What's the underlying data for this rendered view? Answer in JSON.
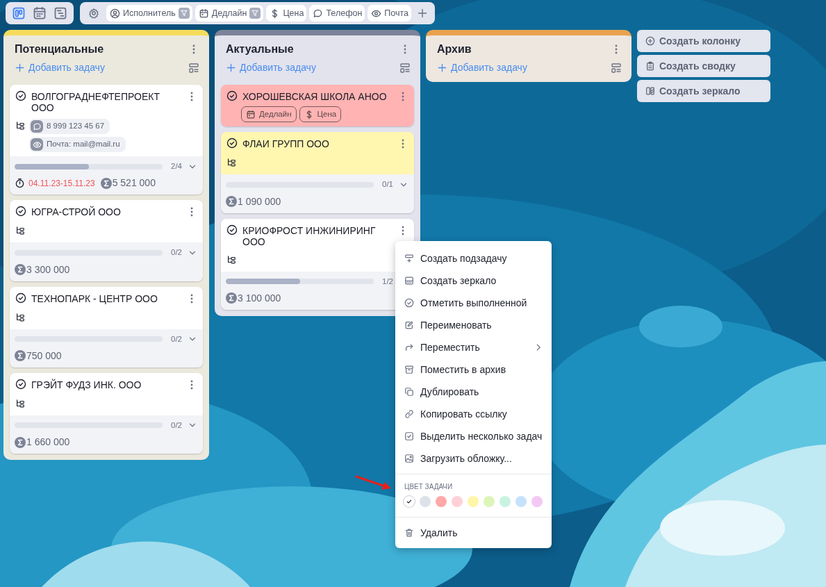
{
  "toolbar": {
    "views": [
      {
        "kind": "board",
        "selected": true
      },
      {
        "kind": "calendar",
        "selected": false
      },
      {
        "kind": "gantt",
        "selected": false
      }
    ],
    "fields": [
      {
        "kind": "user",
        "label": "Исполнитель",
        "filtered": true
      },
      {
        "kind": "calendar",
        "label": "Дедлайн",
        "filtered": true
      },
      {
        "kind": "dollar",
        "label": "Цена",
        "filtered": false
      },
      {
        "kind": "chat",
        "label": "Телефон",
        "filtered": false
      },
      {
        "kind": "eye",
        "label": "Почта",
        "filtered": false
      }
    ]
  },
  "columns": [
    {
      "title": "Потенциальные",
      "color": "#f5dc5c",
      "add_label": "Добавить задачу",
      "cards": [
        {
          "title": "ВОЛГОГРАДНЕФТЕПРОЕКТ ООО",
          "color": "#ffffff",
          "has_subtasks": true,
          "fields": [
            {
              "kind": "chat",
              "text": "8 999 123 45 67"
            },
            {
              "kind": "eye",
              "text": "Почта: mail@mail.ru"
            }
          ],
          "progress": {
            "level": 0.5,
            "text": "2/4"
          },
          "deadline": {
            "text": "04.11.23-15.11.23",
            "overdue": true
          },
          "sum": "5 521 000"
        },
        {
          "title": "ЮГРА-СТРОЙ ООО",
          "color": "#ffffff",
          "has_subtasks": true,
          "progress": {
            "level": 0,
            "text": "0/2"
          },
          "sum": "3 300 000"
        },
        {
          "title": "ТЕХНОПАРК - ЦЕНТР ООО",
          "color": "#ffffff",
          "has_subtasks": true,
          "progress": {
            "level": 0,
            "text": "0/2"
          },
          "sum": "750 000"
        },
        {
          "title": "ГРЭЙТ ФУДЗ ИНК. ООО",
          "color": "#ffffff",
          "has_subtasks": true,
          "progress": {
            "level": 0,
            "text": "0/2"
          },
          "sum": "1 660 000"
        }
      ]
    },
    {
      "title": "Актуальные",
      "color": "#7d8398",
      "add_label": "Добавить задачу",
      "cards": [
        {
          "title": "ХОРОШЕВСКАЯ ШКОЛА АНОО",
          "color": "#ffb3b3",
          "has_subtasks": false,
          "tags": [
            {
              "kind": "calendar",
              "text": "Дедлайн"
            },
            {
              "kind": "dollar",
              "text": "Цена"
            }
          ]
        },
        {
          "title": "ФЛАИ ГРУПП ООО",
          "color": "#fff6b0",
          "has_subtasks": true,
          "progress": {
            "level": 0,
            "text": "0/1"
          },
          "sum": "1 090 000"
        },
        {
          "title": "КРИОФРОСТ ИНЖИНИРИНГ ООО",
          "color": "#ffffff",
          "has_subtasks": true,
          "progress": {
            "level": 0.5,
            "text": "1/2"
          },
          "collapsible": false,
          "sum": "3 100 000"
        }
      ]
    },
    {
      "title": "Архив",
      "color": "#e9a24f",
      "add_label": "Добавить задачу"
    }
  ],
  "actions": [
    {
      "kind": "column",
      "label": "Создать колонку"
    },
    {
      "kind": "summary",
      "label": "Создать сводку"
    },
    {
      "kind": "mirror",
      "label": "Создать зеркало"
    }
  ],
  "context_menu": {
    "items": [
      {
        "kind": "subtask",
        "label": "Создать подзадачу"
      },
      {
        "kind": "mirror",
        "label": "Создать зеркало"
      },
      {
        "kind": "done",
        "label": "Отметить выполненной"
      },
      {
        "kind": "rename",
        "label": "Переименовать"
      },
      {
        "kind": "move",
        "label": "Переместить",
        "submenu": true
      },
      {
        "kind": "archive",
        "label": "Поместить в архив"
      },
      {
        "kind": "copy",
        "label": "Дублировать"
      },
      {
        "kind": "link",
        "label": "Копировать ссылку"
      },
      {
        "kind": "select",
        "label": "Выделить несколько задач"
      },
      {
        "kind": "cover",
        "label": "Загрузить обложку..."
      }
    ],
    "color_label": "ЦВЕТ ЗАДАЧИ",
    "colors": [
      {
        "color": "#ffffff",
        "selected": true
      },
      {
        "color": "#dde1ea",
        "selected": false
      },
      {
        "color": "#ffa8a8",
        "selected": false
      },
      {
        "color": "#ffd0d6",
        "selected": false
      },
      {
        "color": "#fff6a8",
        "selected": false
      },
      {
        "color": "#ddf5b8",
        "selected": false
      },
      {
        "color": "#c8f3e0",
        "selected": false
      },
      {
        "color": "#c5e2fb",
        "selected": false
      },
      {
        "color": "#f4c8f5",
        "selected": false
      }
    ],
    "delete_label": "Удалить"
  }
}
